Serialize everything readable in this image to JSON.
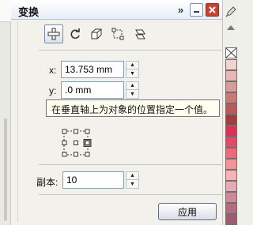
{
  "window": {
    "title": "变换",
    "more_label": "»"
  },
  "tools": [
    {
      "name": "position-tool",
      "icon": "move-cross-icon",
      "active": true
    },
    {
      "name": "rotate-tool",
      "icon": "rotate-icon",
      "active": false
    },
    {
      "name": "scale-tool",
      "icon": "scale-box-icon",
      "active": false
    },
    {
      "name": "size-tool",
      "icon": "size-icon",
      "active": false
    },
    {
      "name": "skew-tool",
      "icon": "skew-icon",
      "active": false
    }
  ],
  "position": {
    "x_label": "x:",
    "x_value": "13.753 mm",
    "y_label": "y:",
    "y_value": ".0 mm"
  },
  "tooltip": "在垂直轴上为对象的位置指定一个值。",
  "copies": {
    "label": "副本:",
    "value": "10"
  },
  "apply_label": "应用",
  "palette": {
    "colors": [
      "#ffffff",
      "#f3d2d2",
      "#e7b6b6",
      "#d99a9a",
      "#c97878",
      "#b95a5a",
      "#a03c3c",
      "#d83452",
      "#e24a67",
      "#ec6b7a",
      "#f39399",
      "#f7b2b5",
      "#e8aab4",
      "#cd8a9a",
      "#b36d82",
      "#9c5d74"
    ]
  }
}
